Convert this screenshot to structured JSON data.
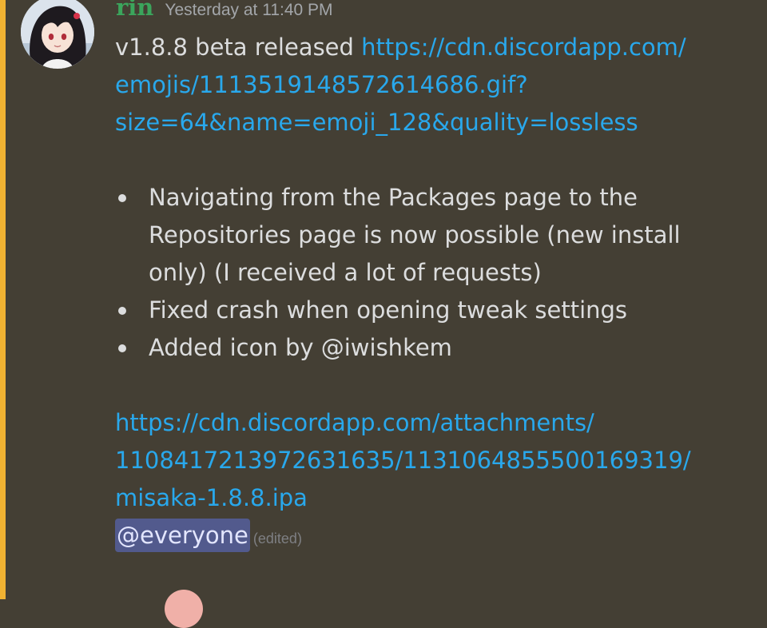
{
  "message": {
    "username": "rin",
    "timestamp": "Yesterday at 11:40 PM",
    "intro_text": "v1.8.8 beta released ",
    "emoji_link_line1": "https://cdn.discordapp.com/",
    "emoji_link_line2": "emojis/1113519148572614686.gif?",
    "emoji_link_line3": "size=64&name=emoji_128&quality=lossless",
    "changes": [
      {
        "line1": "Navigating from the Packages page to the",
        "line2": "Repositories page is now possible (new install",
        "line3": "only) (I received a lot of requests)"
      },
      {
        "line1": "Fixed crash when opening tweak settings"
      },
      {
        "line1": "Added icon by @iwishkem"
      }
    ],
    "attachment_link_line1": "https://cdn.discordapp.com/attachments/",
    "attachment_link_line2": "1108417213972631635/1131064855500169319/",
    "attachment_link_line3": "misaka-1.8.8.ipa",
    "mention": "@everyone",
    "edited_label": "(edited)"
  },
  "colors": {
    "background": "#443f34",
    "mention_bar": "#f0b232",
    "username": "#3ba55c",
    "link": "#29a8ec",
    "mention_bg": "#525a8d"
  },
  "icons": {
    "user_avatar": "anime-girl-avatar-icon",
    "next_avatar": "user-avatar-icon"
  }
}
